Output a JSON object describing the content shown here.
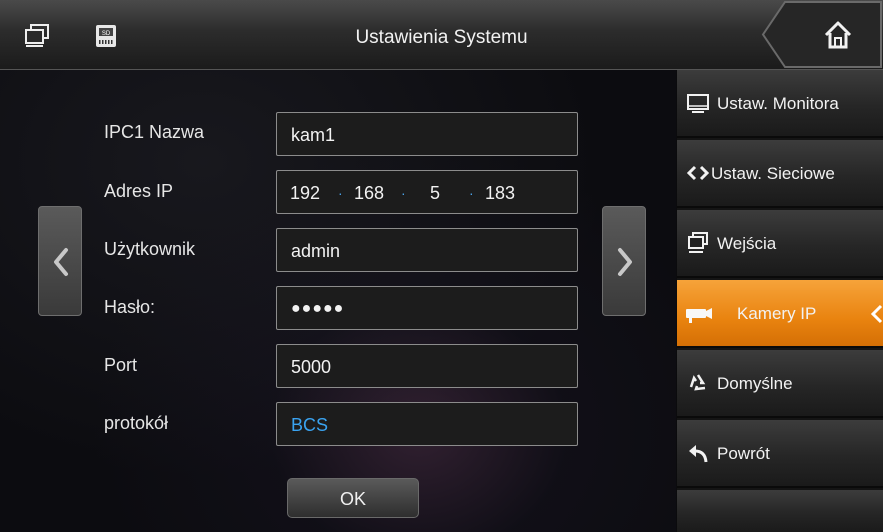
{
  "header": {
    "title": "Ustawienia Systemu",
    "icons": [
      "monitors-icon",
      "sd-card-icon",
      "home-icon"
    ]
  },
  "form": {
    "rows": [
      {
        "label": "IPC1 Nazwa",
        "value": "kam1"
      },
      {
        "label": "Adres IP",
        "ip": [
          "192",
          "168",
          "5",
          "183"
        ]
      },
      {
        "label": "Użytkownik",
        "value": "admin"
      },
      {
        "label": "Hasło:",
        "value": "●●●●●"
      },
      {
        "label": "Port",
        "value": "5000"
      },
      {
        "label": "protokół",
        "value": "BCS"
      }
    ],
    "ok_label": "OK"
  },
  "nav": {
    "left_icon": "chevron-left-icon",
    "right_icon": "chevron-right-icon"
  },
  "sidebar": {
    "items": [
      {
        "label": "Ustaw. Monitora",
        "icon": "monitor-icon"
      },
      {
        "label": "Ustaw. Sieciowe",
        "icon": "network-arrows-icon"
      },
      {
        "label": "Wejścia",
        "icon": "inputs-icon"
      },
      {
        "label": "Kamery IP",
        "icon": "ip-camera-icon",
        "active": true
      },
      {
        "label": "Domyślne",
        "icon": "recycle-icon"
      },
      {
        "label": "Powrót",
        "icon": "back-arrow-icon"
      }
    ]
  },
  "colors": {
    "accent": "#e9830f",
    "protocol_text": "#3aa3f0",
    "ip_dot": "#4aa3e8"
  }
}
